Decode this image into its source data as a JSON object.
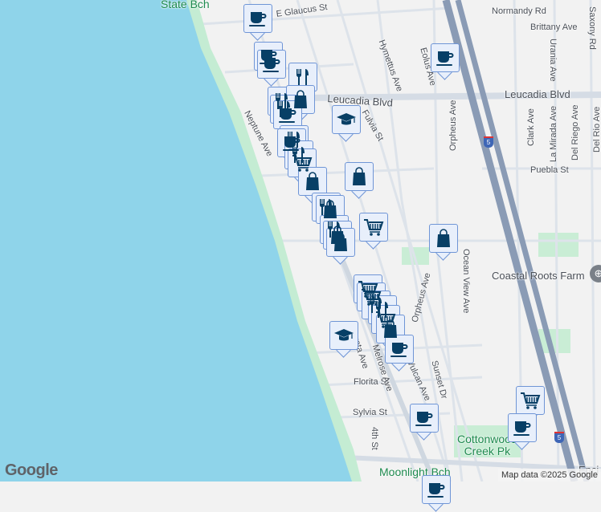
{
  "map": {
    "places": {
      "state_beach": "State Bch",
      "coastal_roots": "Coastal Roots Farm",
      "cottonwood": "Cottonwood\nCreek Pk",
      "moonlight": "Moonlight Bch"
    },
    "streets": {
      "glaucus": "E Glaucus St",
      "normandy": "Normandy Rd",
      "brittany": "Brittany Ave",
      "saxony": "Saxony Rd",
      "hymettus": "Hymettus Ave",
      "eolus": "Eolus Ave",
      "urania": "Urania Ave",
      "leucadia_w": "Leucadia Blvd",
      "leucadia_e": "Leucadia Blvd",
      "fulvia": "Fulvia St",
      "neptune": "Neptune Ave",
      "orpheus": "Orpheus Ave",
      "clark": "Clark Ave",
      "lamirada": "La Mirada Ave",
      "delriego": "Del Riego Ave",
      "delrio": "Del Rio Ave",
      "puebla": "Puebla St",
      "oceanview": "Ocean View Ave",
      "orpheus2": "Orpheus Ave",
      "vulcan": "Vulcan Ave",
      "sunset": "Sunset Dr",
      "florita": "Florita St",
      "sylvia": "Sylvia St",
      "fourth": "4th St",
      "melrose": "Melrose Ave",
      "arata": "Arata Ave",
      "encinitas": "Enci"
    },
    "highway_shield": "5",
    "logo": "Google",
    "attribution": "Map data ©2025 Google"
  },
  "marker_types": {
    "coffee": "coffee-cup-icon",
    "restaurant": "fork-knife-icon",
    "shopping": "shopping-bag-icon",
    "grocery": "shopping-cart-icon",
    "school": "graduation-cap-icon"
  },
  "colors": {
    "water": "#8fd4ea",
    "beach": "#c4ecd3",
    "land": "#f2f2f2",
    "road": "#dde3ea",
    "freeway": "#8a9bb5",
    "marker_fill": "#e8effb",
    "marker_border": "#6f95d6",
    "icon": "#073f66"
  }
}
